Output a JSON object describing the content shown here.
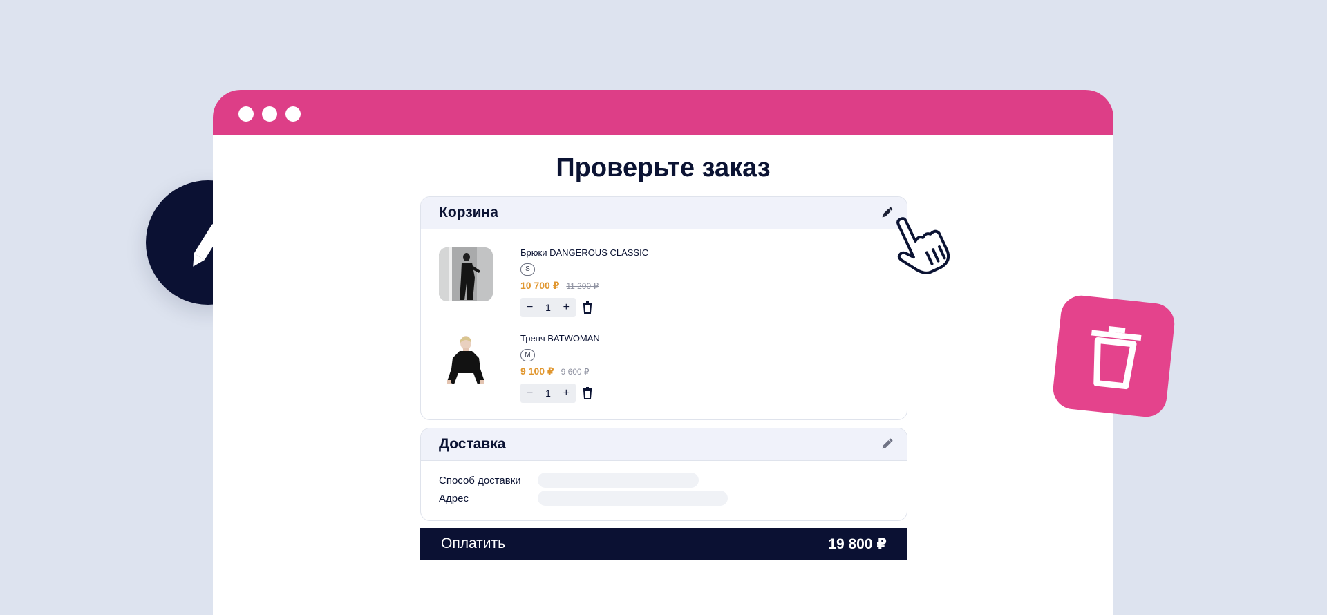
{
  "page": {
    "title": "Проверьте заказ",
    "accent_color": "#dd3e87",
    "dark_color": "#0b1133",
    "background_color": "#dde3ef"
  },
  "window": {
    "controls": [
      "dot",
      "dot",
      "dot"
    ]
  },
  "cart": {
    "title": "Корзина",
    "edit_icon": "pencil-icon",
    "items": [
      {
        "name": "Брюки DANGEROUS CLASSIC",
        "size": "S",
        "price": "10 700 ₽",
        "old_price": "11 200 ₽",
        "quantity": "1",
        "minus": "−",
        "plus": "+",
        "delete_icon": "trash-icon"
      },
      {
        "name": "Тренч BATWOMAN",
        "size": "M",
        "price": "9 100 ₽",
        "old_price": "9 600 ₽",
        "quantity": "1",
        "minus": "−",
        "plus": "+",
        "delete_icon": "trash-icon"
      }
    ]
  },
  "delivery": {
    "title": "Доставка",
    "edit_icon": "pencil-icon",
    "fields": [
      {
        "label": "Способ доставки"
      },
      {
        "label": "Адрес"
      }
    ]
  },
  "pay": {
    "label": "Оплатить",
    "total": "19 800 ₽"
  },
  "decor": {
    "edit_badge_icon": "pencil-icon",
    "trash_badge_icon": "trash-icon",
    "cursor_icon": "hand-pointer-icon"
  }
}
